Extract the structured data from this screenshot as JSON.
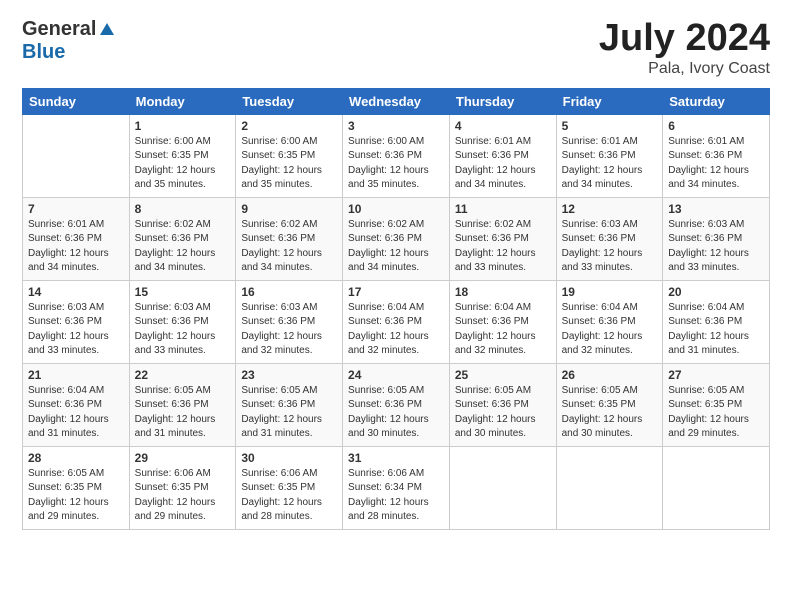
{
  "header": {
    "logo_general": "General",
    "logo_blue": "Blue",
    "month": "July 2024",
    "location": "Pala, Ivory Coast"
  },
  "weekdays": [
    "Sunday",
    "Monday",
    "Tuesday",
    "Wednesday",
    "Thursday",
    "Friday",
    "Saturday"
  ],
  "weeks": [
    [
      {
        "day": "",
        "info": ""
      },
      {
        "day": "1",
        "info": "Sunrise: 6:00 AM\nSunset: 6:35 PM\nDaylight: 12 hours\nand 35 minutes."
      },
      {
        "day": "2",
        "info": "Sunrise: 6:00 AM\nSunset: 6:35 PM\nDaylight: 12 hours\nand 35 minutes."
      },
      {
        "day": "3",
        "info": "Sunrise: 6:00 AM\nSunset: 6:36 PM\nDaylight: 12 hours\nand 35 minutes."
      },
      {
        "day": "4",
        "info": "Sunrise: 6:01 AM\nSunset: 6:36 PM\nDaylight: 12 hours\nand 34 minutes."
      },
      {
        "day": "5",
        "info": "Sunrise: 6:01 AM\nSunset: 6:36 PM\nDaylight: 12 hours\nand 34 minutes."
      },
      {
        "day": "6",
        "info": "Sunrise: 6:01 AM\nSunset: 6:36 PM\nDaylight: 12 hours\nand 34 minutes."
      }
    ],
    [
      {
        "day": "7",
        "info": "Sunrise: 6:01 AM\nSunset: 6:36 PM\nDaylight: 12 hours\nand 34 minutes."
      },
      {
        "day": "8",
        "info": "Sunrise: 6:02 AM\nSunset: 6:36 PM\nDaylight: 12 hours\nand 34 minutes."
      },
      {
        "day": "9",
        "info": "Sunrise: 6:02 AM\nSunset: 6:36 PM\nDaylight: 12 hours\nand 34 minutes."
      },
      {
        "day": "10",
        "info": "Sunrise: 6:02 AM\nSunset: 6:36 PM\nDaylight: 12 hours\nand 34 minutes."
      },
      {
        "day": "11",
        "info": "Sunrise: 6:02 AM\nSunset: 6:36 PM\nDaylight: 12 hours\nand 33 minutes."
      },
      {
        "day": "12",
        "info": "Sunrise: 6:03 AM\nSunset: 6:36 PM\nDaylight: 12 hours\nand 33 minutes."
      },
      {
        "day": "13",
        "info": "Sunrise: 6:03 AM\nSunset: 6:36 PM\nDaylight: 12 hours\nand 33 minutes."
      }
    ],
    [
      {
        "day": "14",
        "info": "Sunrise: 6:03 AM\nSunset: 6:36 PM\nDaylight: 12 hours\nand 33 minutes."
      },
      {
        "day": "15",
        "info": "Sunrise: 6:03 AM\nSunset: 6:36 PM\nDaylight: 12 hours\nand 33 minutes."
      },
      {
        "day": "16",
        "info": "Sunrise: 6:03 AM\nSunset: 6:36 PM\nDaylight: 12 hours\nand 32 minutes."
      },
      {
        "day": "17",
        "info": "Sunrise: 6:04 AM\nSunset: 6:36 PM\nDaylight: 12 hours\nand 32 minutes."
      },
      {
        "day": "18",
        "info": "Sunrise: 6:04 AM\nSunset: 6:36 PM\nDaylight: 12 hours\nand 32 minutes."
      },
      {
        "day": "19",
        "info": "Sunrise: 6:04 AM\nSunset: 6:36 PM\nDaylight: 12 hours\nand 32 minutes."
      },
      {
        "day": "20",
        "info": "Sunrise: 6:04 AM\nSunset: 6:36 PM\nDaylight: 12 hours\nand 31 minutes."
      }
    ],
    [
      {
        "day": "21",
        "info": "Sunrise: 6:04 AM\nSunset: 6:36 PM\nDaylight: 12 hours\nand 31 minutes."
      },
      {
        "day": "22",
        "info": "Sunrise: 6:05 AM\nSunset: 6:36 PM\nDaylight: 12 hours\nand 31 minutes."
      },
      {
        "day": "23",
        "info": "Sunrise: 6:05 AM\nSunset: 6:36 PM\nDaylight: 12 hours\nand 31 minutes."
      },
      {
        "day": "24",
        "info": "Sunrise: 6:05 AM\nSunset: 6:36 PM\nDaylight: 12 hours\nand 30 minutes."
      },
      {
        "day": "25",
        "info": "Sunrise: 6:05 AM\nSunset: 6:36 PM\nDaylight: 12 hours\nand 30 minutes."
      },
      {
        "day": "26",
        "info": "Sunrise: 6:05 AM\nSunset: 6:35 PM\nDaylight: 12 hours\nand 30 minutes."
      },
      {
        "day": "27",
        "info": "Sunrise: 6:05 AM\nSunset: 6:35 PM\nDaylight: 12 hours\nand 29 minutes."
      }
    ],
    [
      {
        "day": "28",
        "info": "Sunrise: 6:05 AM\nSunset: 6:35 PM\nDaylight: 12 hours\nand 29 minutes."
      },
      {
        "day": "29",
        "info": "Sunrise: 6:06 AM\nSunset: 6:35 PM\nDaylight: 12 hours\nand 29 minutes."
      },
      {
        "day": "30",
        "info": "Sunrise: 6:06 AM\nSunset: 6:35 PM\nDaylight: 12 hours\nand 28 minutes."
      },
      {
        "day": "31",
        "info": "Sunrise: 6:06 AM\nSunset: 6:34 PM\nDaylight: 12 hours\nand 28 minutes."
      },
      {
        "day": "",
        "info": ""
      },
      {
        "day": "",
        "info": ""
      },
      {
        "day": "",
        "info": ""
      }
    ]
  ]
}
